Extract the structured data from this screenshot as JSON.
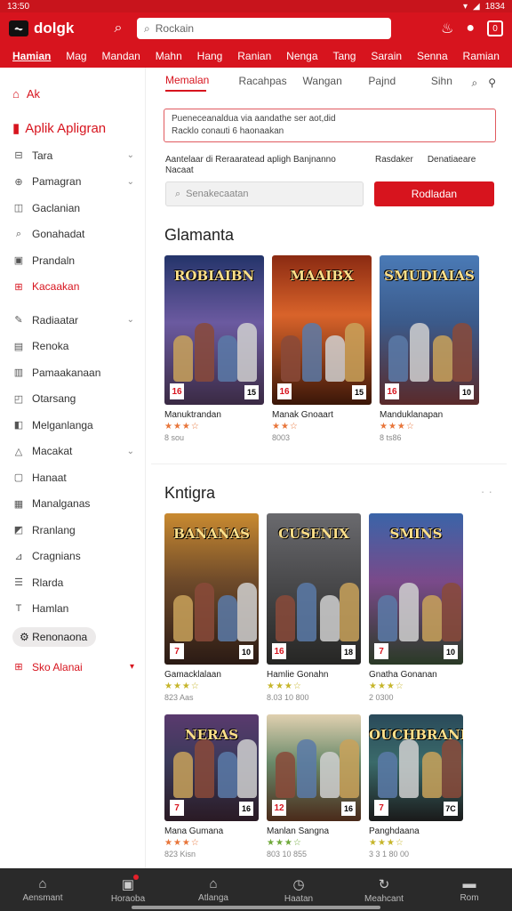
{
  "status": {
    "time": "13:50",
    "battery": "1834"
  },
  "appbar": {
    "brand": "dolgk",
    "search_placeholder": "Rockain",
    "cart_count": "0"
  },
  "categories": [
    "Hamian",
    "Mag",
    "Mandan",
    "Mahn",
    "Hang",
    "Ranian",
    "Nenga",
    "Tang",
    "Sarain",
    "Senna",
    "Ramian"
  ],
  "sidebar": {
    "home_label": "Ak",
    "title": "Aplik Apligran",
    "items": [
      {
        "icon": "grid-icon",
        "label": "Tara",
        "chev": "down",
        "color": "normal"
      },
      {
        "icon": "controller-icon",
        "label": "Pamagran",
        "chev": "down",
        "color": "normal"
      },
      {
        "icon": "square-icon",
        "label": "Gaclanian",
        "chev": "",
        "color": "normal"
      },
      {
        "icon": "search-icon",
        "label": "Gonahadat",
        "chev": "",
        "color": "normal"
      },
      {
        "icon": "box-icon",
        "label": "Prandaln",
        "chev": "",
        "color": "normal"
      },
      {
        "icon": "tag-icon",
        "label": "Kacaakan",
        "chev": "",
        "color": "red"
      },
      {
        "icon": "pen-icon",
        "label": "Radiaatar",
        "chev": "down",
        "color": "normal"
      },
      {
        "icon": "window-icon",
        "label": "Renoka",
        "chev": "",
        "color": "normal"
      },
      {
        "icon": "doc-icon",
        "label": "Pamaakanaan",
        "chev": "",
        "color": "normal"
      },
      {
        "icon": "chat-icon",
        "label": "Otarsang",
        "chev": "",
        "color": "normal"
      },
      {
        "icon": "photo-icon",
        "label": "Melganlanga",
        "chev": "",
        "color": "normal"
      },
      {
        "icon": "drop-icon",
        "label": "Macakat",
        "chev": "down",
        "color": "normal"
      },
      {
        "icon": "frame-icon",
        "label": "Hanaat",
        "chev": "",
        "color": "normal"
      },
      {
        "icon": "bars-icon",
        "label": "Manalganas",
        "chev": "",
        "color": "normal"
      },
      {
        "icon": "image-icon",
        "label": "Rranlang",
        "chev": "",
        "color": "normal"
      },
      {
        "icon": "link-icon",
        "label": "Cragnians",
        "chev": "",
        "color": "normal"
      },
      {
        "icon": "list-icon",
        "label": "Rlarda",
        "chev": "",
        "color": "normal"
      },
      {
        "icon": "text-icon",
        "label": "Hamlan",
        "chev": "",
        "color": "normal"
      }
    ],
    "pill_label": "Renonaona",
    "footer_label": "Sko Alanai"
  },
  "tabs": {
    "items": [
      "Memalan",
      "Racahpas",
      "Wangan",
      "Pajnd",
      "Sihn"
    ],
    "active_index": 0
  },
  "notice": {
    "line1": "Pueneceanaldua via aandathe ser aot,did",
    "line2": "Racklo conauti 6 haonaakan"
  },
  "filters": {
    "f1": "Aantelaar di  Reraaratead apligh Banjnanno Nacaat",
    "f2": "Rasdaker",
    "f3": "Denatiaeare"
  },
  "search_row": {
    "placeholder": "Senakecaatan",
    "button": "Rodladan"
  },
  "section1": {
    "title": "Glamanta",
    "cards": [
      {
        "cover_title": "ROBIAIBN",
        "name": "Manuktrandan",
        "stars": "★★★☆",
        "meta": "8 sou",
        "rating": "16",
        "pegi": "15",
        "bg": "linear-gradient(180deg,#24346a 0%,#6b5aa0 45%,#3a2a44 100%)",
        "star_color": "orange"
      },
      {
        "cover_title": "MAAIBX",
        "name": "Manak Gnoaart",
        "stars": "★★☆",
        "meta": "8003",
        "rating": "16",
        "pegi": "15",
        "bg": "linear-gradient(180deg,#8a2a12 0%,#d9632a 40%,#3a1608 100%)",
        "star_color": "orange"
      },
      {
        "cover_title": "SMUDIAIAS",
        "name": "Manduklanapan",
        "stars": "★★★☆",
        "meta": "8 ts86",
        "rating": "16",
        "pegi": "10",
        "bg": "linear-gradient(180deg,#4a7ab6 0%,#3b5a8a 45%,#5a2a2a 100%)",
        "star_color": "orange"
      }
    ]
  },
  "section2": {
    "title": "Kntigra",
    "more": "· ·",
    "cards": [
      {
        "cover_title": "BANANAS",
        "name": "Gamacklalaan",
        "stars": "★★★☆",
        "meta": "823 Aas",
        "rating": "7",
        "pegi": "10",
        "bg": "linear-gradient(180deg,#c98a30 0%,#6e4a2a 45%,#2a1a14 100%)",
        "star_color": "yellow"
      },
      {
        "cover_title": "CUSENIX",
        "name": "Hamlie Gonahn",
        "stars": "★★★☆",
        "meta": "8.03 10 800",
        "rating": "16",
        "pegi": "18",
        "bg": "linear-gradient(180deg,#6a6a6e 0%,#4a4a4c 45%,#262624 100%)",
        "star_color": "yellow"
      },
      {
        "cover_title": "SMINS",
        "name": "Gnatha Gonanan",
        "stars": "★★★☆",
        "meta": "2 0300",
        "rating": "7",
        "pegi": "10",
        "bg": "linear-gradient(180deg,#3a64a8 0%,#7a4a8a 45%,#2a3a26 100%)",
        "star_color": "yellow"
      }
    ]
  },
  "section3": {
    "cards": [
      {
        "cover_title": "NERAS",
        "name": "Mana Gumana",
        "stars": "★★★☆",
        "meta": "823 Kisn",
        "rating": "7",
        "pegi": "16",
        "bg": "linear-gradient(180deg,#5a3a6e 0%,#3a3a5a 45%,#2a1a24 100%)",
        "star_color": "orange"
      },
      {
        "cover_title": "",
        "name": "Manlan Sangna",
        "stars": "★★★☆",
        "meta": "803 10 855",
        "rating": "12",
        "pegi": "16",
        "bg": "linear-gradient(180deg,#e0d0b0 0%,#6a8a6a 45%,#4a2a1a 100%)",
        "star_color": "green"
      },
      {
        "cover_title": "OUCHBRANE",
        "name": "Panghdaana",
        "stars": "★★★☆",
        "meta": "3 3 1 80 00",
        "rating": "7",
        "pegi": "7C",
        "bg": "linear-gradient(180deg,#2a4a5a 0%,#3a6a6a 45%,#1a1a1a 100%)",
        "star_color": "yellow"
      }
    ]
  },
  "bottomnav": [
    {
      "icon": "home-icon",
      "label": "Aensmant"
    },
    {
      "icon": "bag-icon",
      "label": "Horaoba"
    },
    {
      "icon": "store-icon",
      "label": "Atlanga"
    },
    {
      "icon": "clock-icon",
      "label": "Haatan"
    },
    {
      "icon": "refresh-icon",
      "label": "Meahcant"
    },
    {
      "icon": "chat-bubble-icon",
      "label": "Rom"
    }
  ]
}
